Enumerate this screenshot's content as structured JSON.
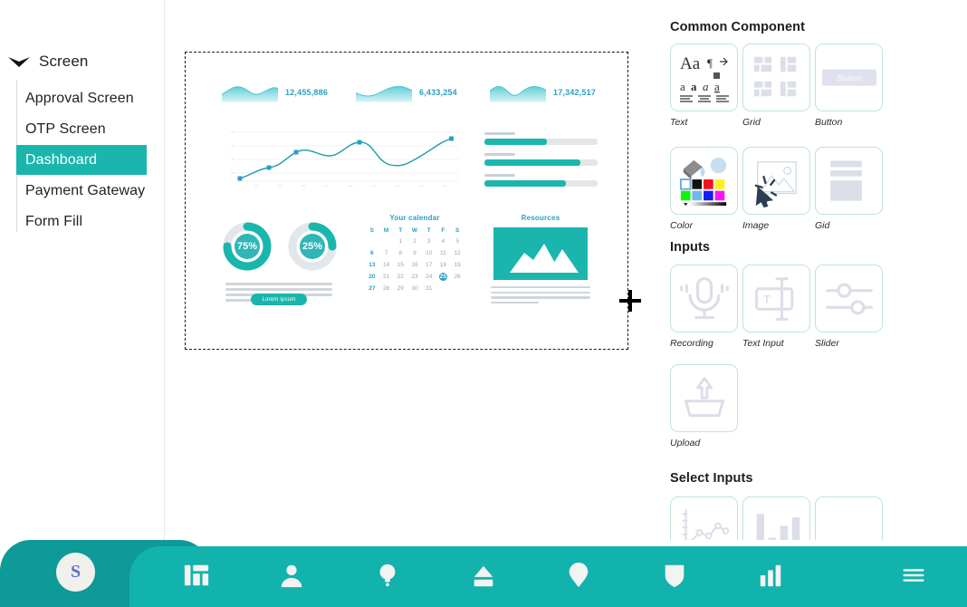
{
  "sidebar": {
    "root_label": "Screen",
    "root_icon": "chevron-down-icon",
    "items": [
      {
        "label": "Approval Screen",
        "active": false
      },
      {
        "label": "OTP Screen",
        "active": false
      },
      {
        "label": "Dashboard",
        "active": true
      },
      {
        "label": "Payment Gateway",
        "active": false
      },
      {
        "label": "Form Fill",
        "active": false
      }
    ]
  },
  "canvas": {
    "cursor_icon": "crosshair-cursor",
    "dashboard": {
      "stats": [
        {
          "value": "12,455,886",
          "icon": "sparkline-area-icon"
        },
        {
          "value": "6,433,254",
          "icon": "sparkline-area-icon"
        },
        {
          "value": "17,342,517",
          "icon": "sparkline-area-icon"
        }
      ],
      "progress_bars": [
        {
          "percent": 55
        },
        {
          "percent": 85
        },
        {
          "percent": 72
        }
      ],
      "donuts": [
        {
          "label": "75%",
          "percent": 75
        },
        {
          "label": "25%",
          "percent": 25
        }
      ],
      "cta_label": "Lorem ipsum",
      "calendar": {
        "title": "Your calendar",
        "weekdays": [
          "S",
          "M",
          "T",
          "W",
          "T",
          "F",
          "S"
        ],
        "leading_blanks": 2,
        "days": [
          1,
          2,
          3,
          4,
          5,
          6,
          7,
          8,
          9,
          10,
          11,
          12,
          13,
          14,
          15,
          16,
          17,
          18,
          19,
          20,
          21,
          22,
          23,
          24,
          25,
          26,
          27,
          28,
          29,
          30,
          31
        ],
        "selected_day": 25
      },
      "resources": {
        "title": "Resources",
        "image_icon": "mountain-image-icon"
      }
    }
  },
  "panel": {
    "sections": [
      {
        "title": "Common Component",
        "items": [
          {
            "label": "Text",
            "icon": "text-format-icon"
          },
          {
            "label": "Grid",
            "icon": "grid-layout-icon"
          },
          {
            "label": "Button",
            "icon": "button-icon",
            "inner_text": "Button"
          },
          {
            "label": "Color",
            "icon": "color-palette-icon"
          },
          {
            "label": "Image",
            "icon": "image-cursor-icon"
          },
          {
            "label": "Gid",
            "icon": "list-block-icon"
          }
        ]
      },
      {
        "title": "Inputs",
        "items": [
          {
            "label": "Recording",
            "icon": "microphone-icon"
          },
          {
            "label": "Text Input",
            "icon": "text-input-icon"
          },
          {
            "label": "Slider",
            "icon": "slider-icon"
          },
          {
            "label": "Upload",
            "icon": "upload-tray-icon"
          }
        ]
      },
      {
        "title": "Select Inputs",
        "items": [
          {
            "label": "",
            "icon": "line-chart-icon"
          },
          {
            "label": "",
            "icon": "bar-chart-icon"
          },
          {
            "label": "",
            "icon": "blank-icon"
          }
        ]
      }
    ]
  },
  "bottombar": {
    "avatar_initial": "S",
    "icons": [
      "dashboard-grid-icon",
      "user-icon",
      "lightbulb-icon",
      "eject-icon",
      "location-pin-icon",
      "shield-icon",
      "bar-chart-icon",
      "hamburger-menu-icon"
    ]
  },
  "colors": {
    "teal": "#1ab6ad",
    "teal_dark": "#0e9a96",
    "blue": "#2b9fc4",
    "card_border": "#bfe3df"
  }
}
